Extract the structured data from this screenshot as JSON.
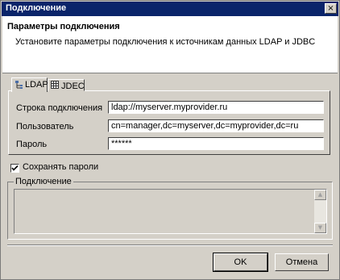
{
  "window": {
    "title": "Подключение",
    "close_glyph": "×"
  },
  "header": {
    "title": "Параметры подключения",
    "description": "Установите параметры подключения к источникам данных LDAP и JDBC"
  },
  "tabs": [
    {
      "label": "LDAP",
      "icon": "ldap-tree-icon",
      "active": true
    },
    {
      "label": "JDEC",
      "icon": "table-icon",
      "active": false
    }
  ],
  "form": {
    "connection_string": {
      "label": "Строка подключения",
      "value": "ldap://myserver.myprovider.ru"
    },
    "user": {
      "label": "Пользователь",
      "value": "cn=manager,dc=myserver,dc=myprovider,dc=ru"
    },
    "password": {
      "label": "Пароль",
      "value": "******"
    }
  },
  "save_passwords": {
    "label": "Сохранять пароли",
    "checked": true
  },
  "connection_group": {
    "title": "Подключение",
    "text": ""
  },
  "buttons": {
    "ok": "OK",
    "cancel": "Отмена"
  },
  "colors": {
    "titlebar": "#0a246a",
    "face": "#d4d0c8"
  }
}
